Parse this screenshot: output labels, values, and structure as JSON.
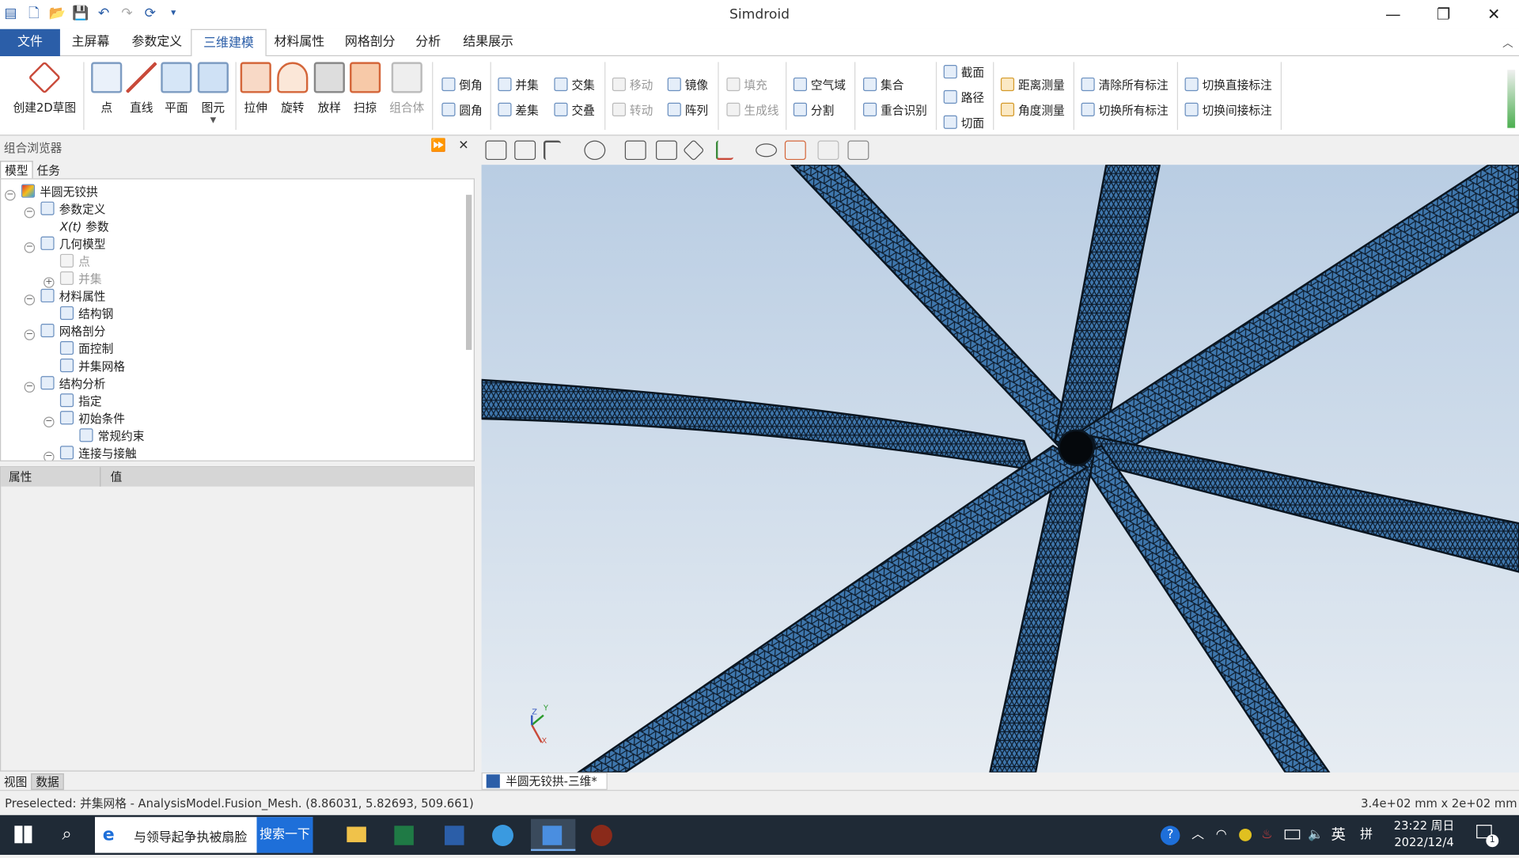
{
  "app": {
    "title": "Simdroid"
  },
  "window_controls": {
    "minimize": "—",
    "restore": "❐",
    "close": "✕"
  },
  "menu": {
    "file": "文件",
    "tabs": [
      "主屏幕",
      "参数定义",
      "三维建模",
      "材料属性",
      "网格剖分",
      "分析",
      "结果展示"
    ],
    "active_tab": "三维建模"
  },
  "ribbon": {
    "create_sketch": "创建2D草图",
    "point": "点",
    "line": "直线",
    "plane": "平面",
    "primitive": "图元",
    "extrude": "拉伸",
    "revolve": "旋转",
    "loft": "放样",
    "sweep": "扫掠",
    "compound": "组合体",
    "chamfer": "倒角",
    "fillet": "圆角",
    "union": "并集",
    "difference": "差集",
    "intersect": "交集",
    "overlap": "交叠",
    "move": "移动",
    "rotate": "转动",
    "mirror": "镜像",
    "array": "阵列",
    "fill": "填充",
    "generate_line": "生成线",
    "air_domain": "空气域",
    "split": "分割",
    "collection": "集合",
    "overlap_detect": "重合识别",
    "section": "截面",
    "path": "路径",
    "cut_face": "切面",
    "distance_measure": "距离测量",
    "angle_measure": "角度测量",
    "clear_all_marks": "清除所有标注",
    "toggle_all_marks": "切换所有标注",
    "toggle_direct_marks": "切换直接标注",
    "toggle_indirect_marks": "切换间接标注"
  },
  "browser": {
    "title": "组合浏览器",
    "tabs": [
      "模型",
      "任务"
    ],
    "tree": [
      {
        "label": "半圆无铰拱",
        "level": 0,
        "exp": "−"
      },
      {
        "label": "参数定义",
        "level": 1,
        "exp": "−"
      },
      {
        "label": "参数",
        "level": 2,
        "prefix": "X(t)"
      },
      {
        "label": "几何模型",
        "level": 1,
        "exp": "−"
      },
      {
        "label": "点",
        "level": 2,
        "dim": true
      },
      {
        "label": "并集",
        "level": 2,
        "exp": "+",
        "dim": true
      },
      {
        "label": "材料属性",
        "level": 1,
        "exp": "−"
      },
      {
        "label": "结构钢",
        "level": 2
      },
      {
        "label": "网格剖分",
        "level": 1,
        "exp": "−"
      },
      {
        "label": "面控制",
        "level": 2
      },
      {
        "label": "并集网格",
        "level": 2
      },
      {
        "label": "结构分析",
        "level": 1,
        "exp": "−"
      },
      {
        "label": "指定",
        "level": 2
      },
      {
        "label": "初始条件",
        "level": 2,
        "exp": "−"
      },
      {
        "label": "常规约束",
        "level": 3
      },
      {
        "label": "连接与接触",
        "level": 2,
        "exp": "−"
      }
    ]
  },
  "properties": {
    "col_property": "属性",
    "col_value": "值"
  },
  "bottom_tabs": [
    "视图",
    "数据"
  ],
  "document_tab": "半圆无铰拱-三维*",
  "axis": {
    "z": "Z",
    "y": "Y",
    "x": "X"
  },
  "status": {
    "left": "Preselected: 并集网格 - AnalysisModel.Fusion_Mesh. (8.86031, 5.82693, 509.661)",
    "right": "3.4e+02 mm x 2e+02 mm"
  },
  "taskbar": {
    "search_text": "与领导起争执被扇脸",
    "search_button": "搜索一下",
    "time": "23:22 周日",
    "date": "2022/12/4",
    "ime_lang": "英",
    "ime_mode": "拼",
    "notification_count": "1"
  },
  "colors": {
    "accent": "#2b5ea8",
    "mesh": "#3a6a9c",
    "taskbar": "#1f2a36"
  }
}
